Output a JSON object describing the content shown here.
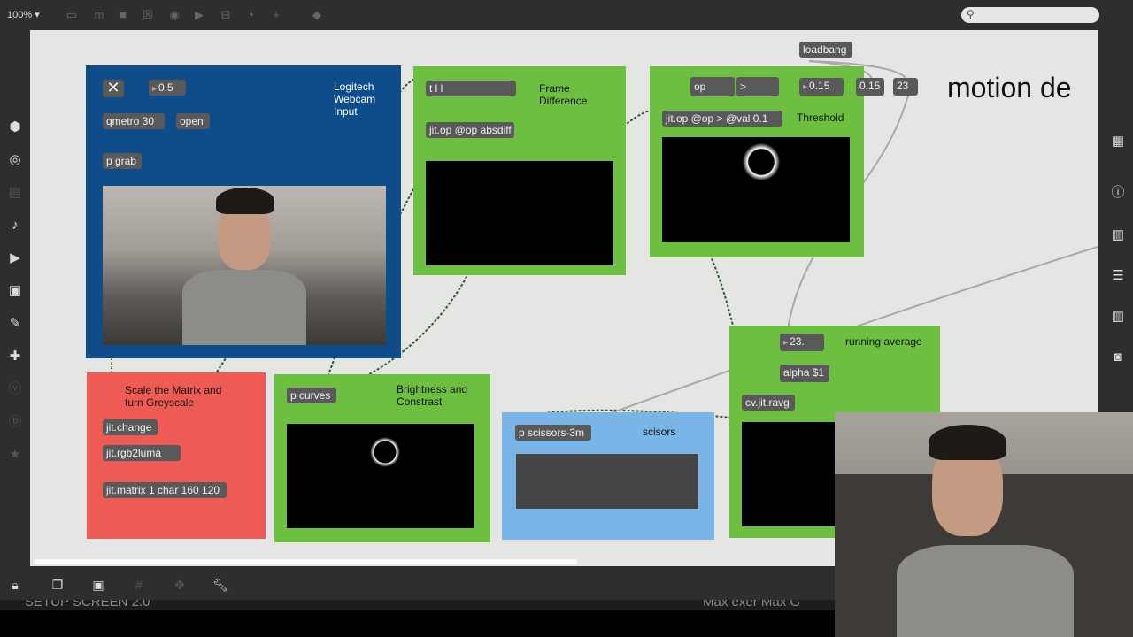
{
  "toolbar": {
    "zoom": "100%",
    "icons": [
      "presentation-icon",
      "message-icon",
      "comment-icon",
      "button-icon",
      "toggle-icon",
      "slider-icon",
      "number-icon",
      "dial-icon",
      "plus-icon",
      "paint-bucket-icon"
    ]
  },
  "search": {
    "placeholder": ""
  },
  "title": "motion de",
  "panels": {
    "webcam": {
      "label": "Logitech\nWebcam\nInput",
      "number": "0.5",
      "qmetro": "qmetro 30",
      "open": "open",
      "grab": "p grab"
    },
    "scale": {
      "label": "Scale the Matrix and\nturn Greyscale",
      "change": "jit.change",
      "luma": "jit.rgb2luma",
      "matrix": "jit.matrix 1 char 160 120"
    },
    "brightness": {
      "label": "Brightness and\nConstrast",
      "curves": "p curves"
    },
    "frame": {
      "label": "Frame\nDifference",
      "trigger": "t l l",
      "absdiff": "jit.op @op absdiff"
    },
    "threshold": {
      "label": "Threshold",
      "op_label": "op",
      "op_value": ">",
      "val": "0.15",
      "jitop": "jit.op @op > @val 0.1"
    },
    "scissors": {
      "label": "scisors",
      "obj": "p scissors-3m"
    },
    "average": {
      "label": "running average",
      "number": "23.",
      "alpha": "alpha $1",
      "ravg": "cv.jit.ravg"
    }
  },
  "loadbang": "loadbang",
  "msg_015": "0.15",
  "msg_23": "23",
  "underbar": {
    "left": "SETUP SCREEN 2.0",
    "right": "Max exer Max G"
  },
  "colors": {
    "blue_panel": "#0f4c8a",
    "green_panel": "#6cbf3f",
    "red_panel": "#ee5b55",
    "light_blue_panel": "#7ab5e8",
    "canvas": "#e5e5e3",
    "object": "#595959"
  }
}
